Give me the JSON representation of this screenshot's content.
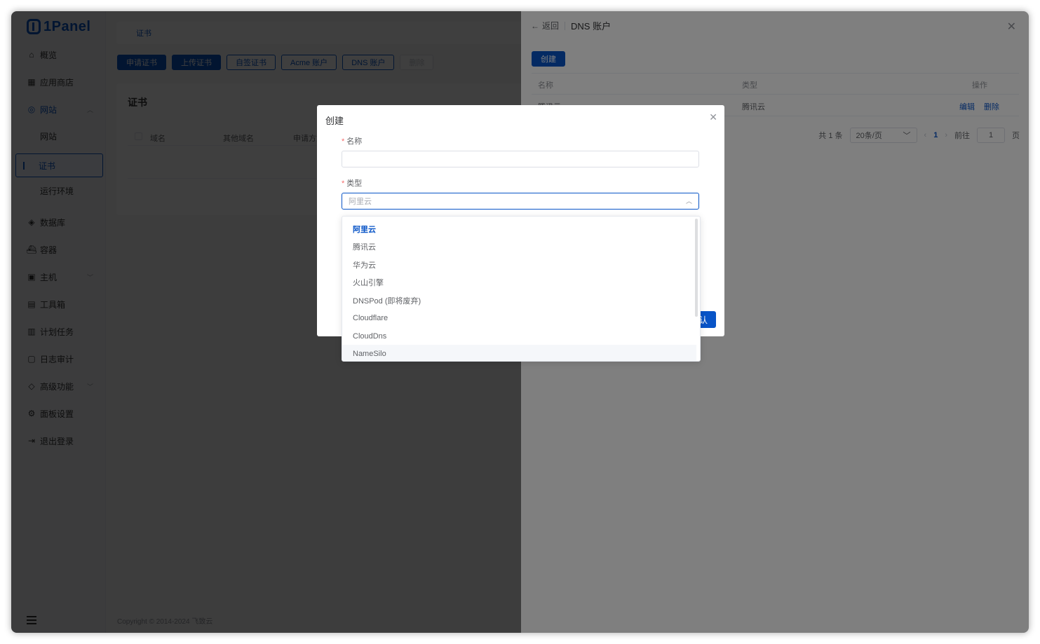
{
  "app": {
    "logo_text": "1Panel"
  },
  "sidebar": {
    "items": [
      {
        "label": "概览",
        "icon": "home-icon"
      },
      {
        "label": "应用商店",
        "icon": "apps-grid-icon"
      },
      {
        "label": "网站",
        "icon": "globe-icon",
        "expanded": true
      },
      {
        "label": "网站"
      },
      {
        "label": "证书",
        "active": true
      },
      {
        "label": "运行环境"
      },
      {
        "label": "数据库",
        "icon": "layers-icon"
      },
      {
        "label": "容器",
        "icon": "docker-icon"
      },
      {
        "label": "主机",
        "icon": "host-icon"
      },
      {
        "label": "工具箱",
        "icon": "toolbox-icon"
      },
      {
        "label": "计划任务",
        "icon": "calendar-icon"
      },
      {
        "label": "日志审计",
        "icon": "log-icon"
      },
      {
        "label": "高级功能",
        "icon": "diamond-icon"
      },
      {
        "label": "面板设置",
        "icon": "gear-icon"
      },
      {
        "label": "退出登录",
        "icon": "logout-icon"
      }
    ]
  },
  "main": {
    "breadcrumb": "证书",
    "toolbar": {
      "apply": "申请证书",
      "upload": "上传证书",
      "self_signed": "自签证书",
      "acme": "Acme 账户",
      "dns": "DNS 账户",
      "delete": "删除"
    },
    "card_title": "证书",
    "columns": [
      "域名",
      "其他域名",
      "申请方式"
    ],
    "footer": "Copyright © 2014-2024 飞致云"
  },
  "drawer": {
    "back_label": "返回",
    "title": "DNS 账户",
    "create_label": "创建",
    "columns": [
      "名称",
      "类型",
      "操作"
    ],
    "rows": [
      {
        "name": "腾讯云",
        "type": "腾讯云",
        "edit": "编辑",
        "delete": "删除"
      }
    ],
    "pagination": {
      "total": "共 1 条",
      "page_size": "20条/页",
      "current": "1",
      "goto_prefix": "前往",
      "goto_value": "1",
      "goto_suffix": "页"
    }
  },
  "dialog": {
    "title": "创建",
    "name_label": "名称",
    "name_value": "",
    "type_label": "类型",
    "type_value": "阿里云",
    "confirm_label": "认"
  },
  "dropdown": {
    "options": [
      "阿里云",
      "腾讯云",
      "华为云",
      "火山引擎",
      "DNSPod (即将废弃)",
      "Cloudflare",
      "CloudDns",
      "NameSilo"
    ],
    "selected": "阿里云",
    "hovered": "NameSilo"
  },
  "colors": {
    "primary": "#0854c7",
    "danger": "#f56c6c",
    "overlay": "rgba(0,0,0,0.5)"
  }
}
